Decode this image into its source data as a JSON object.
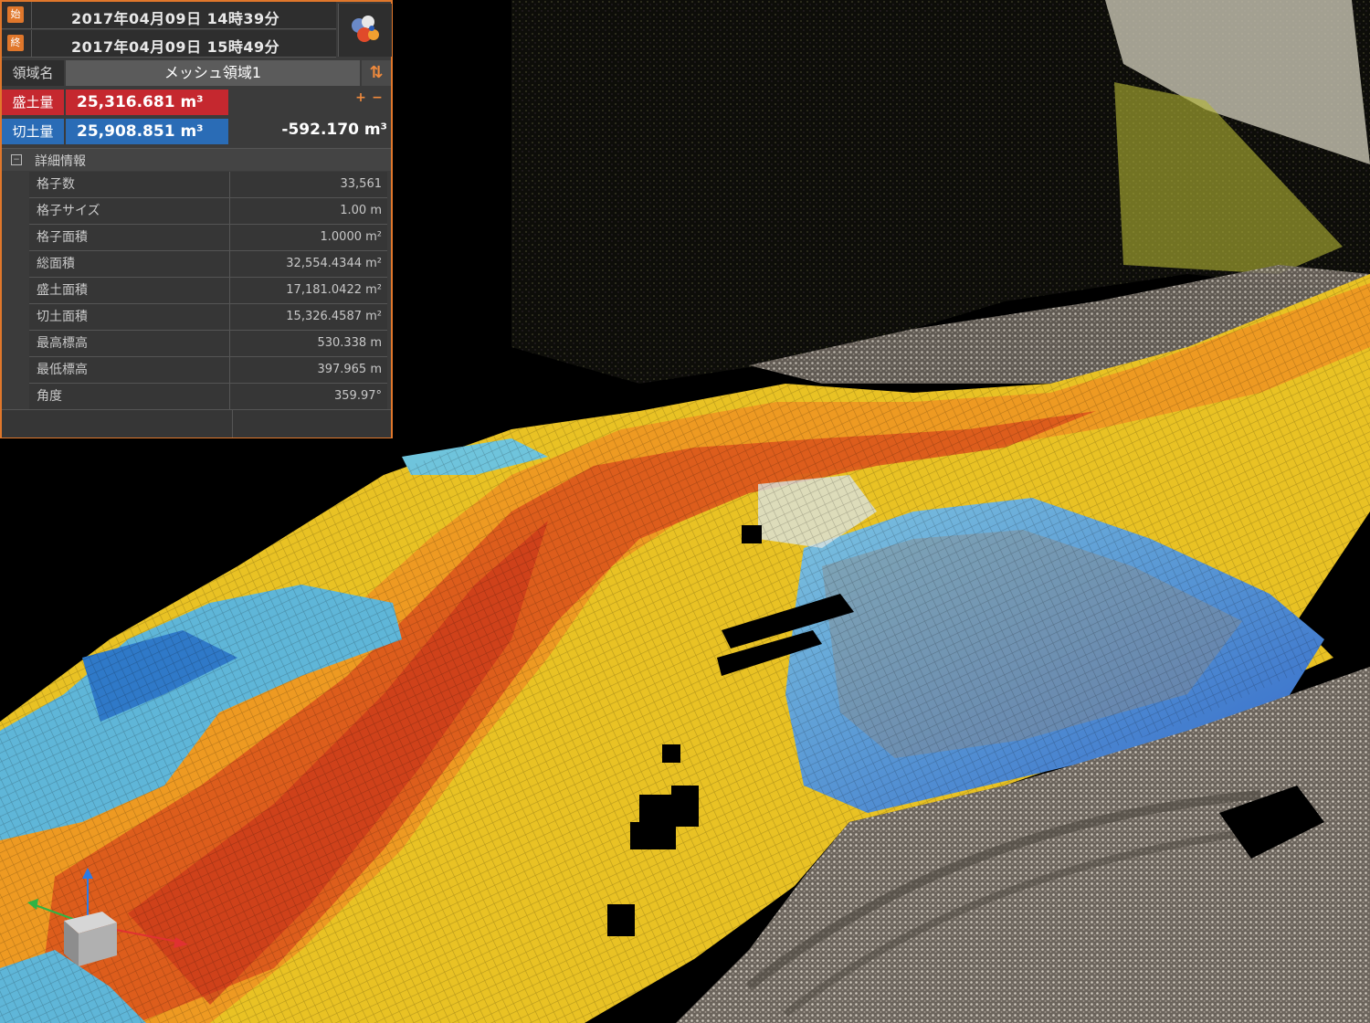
{
  "panel": {
    "date_start_icon": "始",
    "date_end_icon": "終",
    "date_start": "2017年04月09日 14時39分",
    "date_end": "2017年04月09日 15時49分",
    "color_icon": "color-palette-icon",
    "region_label": "領域名",
    "region_name": "メッシュ領域1",
    "sort_icon": "⇅",
    "fill_label": "盛土量",
    "fill_volume": "25,316.681 m³",
    "cut_label": "切土量",
    "cut_volume": "25,908.851 m³",
    "plus": "+",
    "minus": "−",
    "difference": "-592.170 m³",
    "detail_header": "詳細情報",
    "detail_rows": [
      {
        "key": "格子数",
        "value": "33,561"
      },
      {
        "key": "格子サイズ",
        "value": "1.00 m"
      },
      {
        "key": "格子面積",
        "value": "1.0000 m²"
      },
      {
        "key": "総面積",
        "value": "32,554.4344 m²"
      },
      {
        "key": "盛土面積",
        "value": "17,181.0422 m²"
      },
      {
        "key": "切土面積",
        "value": "15,326.4587 m²"
      },
      {
        "key": "最高標高",
        "value": "530.338 m"
      },
      {
        "key": "最低標高",
        "value": "397.965 m"
      },
      {
        "key": "角度",
        "value": "359.97°"
      }
    ]
  },
  "colors": {
    "accent": "#e0772b",
    "fill": "#c5282f",
    "cut": "#2a6cb6"
  },
  "viewport": {
    "gizmo_icon": "axis-cube-icon"
  }
}
